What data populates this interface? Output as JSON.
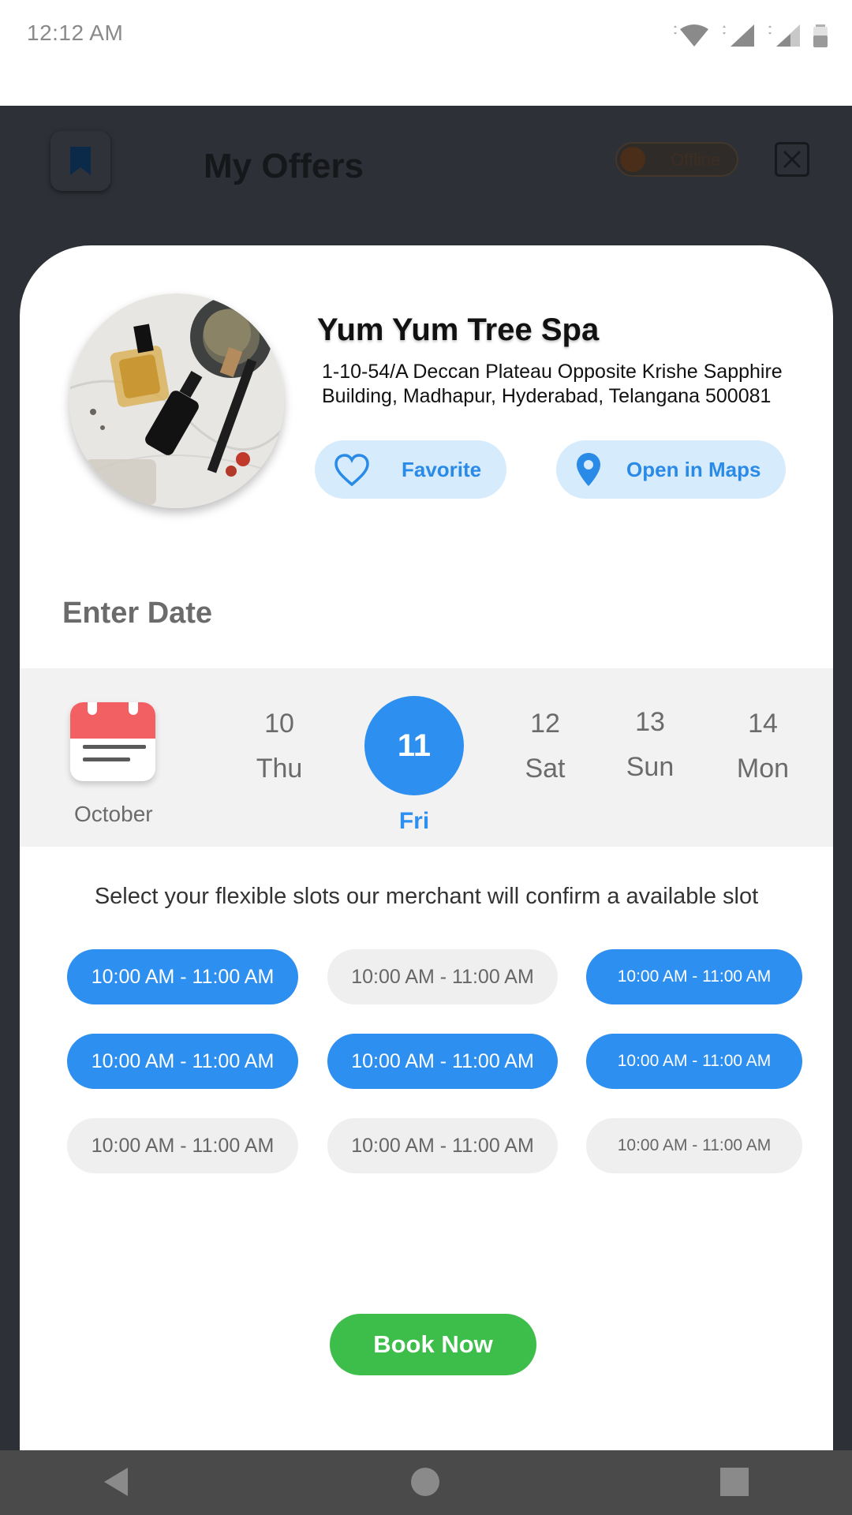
{
  "status_bar": {
    "time": "12:12 AM",
    "icons": [
      "wifi-icon",
      "signal-icon",
      "signal-icon",
      "battery-icon"
    ]
  },
  "background_app": {
    "title": "My Offers",
    "status_toggle": "Offline"
  },
  "shop": {
    "name": "Yum Yum Tree Spa",
    "address": "1-10-54/A Deccan Plateau Opposite Krishe Sapphire Building, Madhapur, Hyderabad, Telangana 500081",
    "favorite_label": "Favorite",
    "maps_label": "Open in Maps"
  },
  "date_picker": {
    "heading": "Enter Date",
    "month": "October",
    "days": [
      {
        "num": "10",
        "weekday": "Thu",
        "selected": false
      },
      {
        "num": "11",
        "weekday": "Fri",
        "selected": true
      },
      {
        "num": "12",
        "weekday": "Sat",
        "selected": false
      },
      {
        "num": "13",
        "weekday": "Sun",
        "selected": false
      },
      {
        "num": "14",
        "weekday": "Mon",
        "selected": false
      }
    ]
  },
  "slots": {
    "hint": "Select your flexible slots our merchant will confirm a available slot",
    "items": [
      {
        "label": "10:00 AM - 11:00 AM",
        "selected": true
      },
      {
        "label": "10:00 AM - 11:00 AM",
        "selected": false
      },
      {
        "label": "10:00 AM - 11:00 AM",
        "selected": true
      },
      {
        "label": "10:00 AM - 11:00 AM",
        "selected": true
      },
      {
        "label": "10:00 AM - 11:00 AM",
        "selected": true
      },
      {
        "label": "10:00 AM - 11:00 AM",
        "selected": true
      },
      {
        "label": "10:00 AM - 11:00 AM",
        "selected": false
      },
      {
        "label": "10:00 AM - 11:00 AM",
        "selected": false
      },
      {
        "label": "10:00 AM - 11:00 AM",
        "selected": false
      }
    ]
  },
  "book_label": "Book Now",
  "colors": {
    "accent": "#2d8ff0",
    "accent_light": "#d6ebfb",
    "book": "#3dbe4a",
    "calendar_red": "#f26064"
  }
}
